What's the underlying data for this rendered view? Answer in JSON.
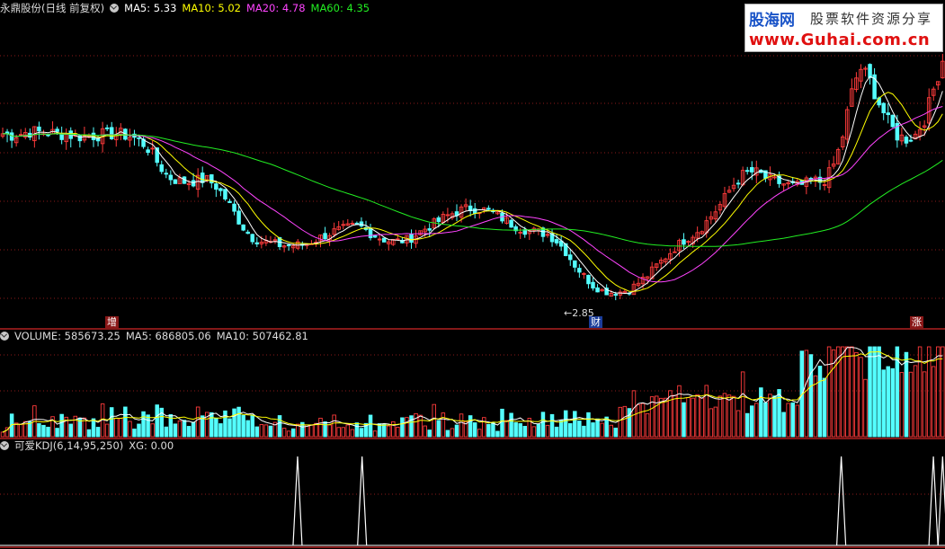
{
  "main_panel": {
    "stock_name": "永鼎股份",
    "period_label": "(日线 前复权)",
    "indicators": [
      {
        "label": "MA5: 5.33",
        "color": "#ffffff"
      },
      {
        "label": "MA10: 5.02",
        "color": "#ffff00"
      },
      {
        "label": "MA20: 4.78",
        "color": "#ff44ff"
      },
      {
        "label": "MA60: 4.35",
        "color": "#22ee22"
      }
    ],
    "low_marker": "←2.85",
    "markers": [
      {
        "label": "增",
        "bg": "#8a1818"
      },
      {
        "label": "财",
        "bg": "#1a3c9a"
      },
      {
        "label": "涨",
        "bg": "#8a1818"
      }
    ]
  },
  "volume_panel": {
    "title": "VOLUME: 585673.25",
    "ma5": "MA5: 686805.06",
    "ma10": "MA10: 507462.81"
  },
  "kdj_panel": {
    "title": "可爱KDJ(6,14,95,250)",
    "xg": "XG: 0.00"
  },
  "logo": {
    "brand": "股海网",
    "tagline": "股票软件资源分享",
    "url": "www.Guhai.com.cn"
  },
  "colors": {
    "up": "#ff3b3b",
    "down": "#54ffff",
    "ma5": "#ffffff",
    "ma10": "#ffff00",
    "ma20": "#ff44ff",
    "ma60": "#22ee22",
    "grid": "#8b1a1a"
  },
  "chart_data": {
    "type": "candlestick",
    "price_low_annotation": 2.85,
    "ma_last": {
      "MA5": 5.33,
      "MA10": 5.02,
      "MA20": 4.78,
      "MA60": 4.35
    },
    "close_series_approx": [
      5.02,
      5.0,
      5.02,
      5.05,
      5.04,
      5.03,
      5.02,
      5.01,
      4.99,
      4.98,
      5.0,
      5.01,
      5.02,
      5.01,
      4.98,
      4.92,
      4.8,
      4.6,
      4.45,
      4.4,
      4.38,
      4.4,
      4.42,
      4.35,
      4.2,
      4.0,
      3.8,
      3.65,
      3.6,
      3.58,
      3.55,
      3.54,
      3.55,
      3.57,
      3.62,
      3.68,
      3.73,
      3.76,
      3.79,
      3.78,
      3.7,
      3.64,
      3.6,
      3.6,
      3.62,
      3.7,
      3.78,
      3.84,
      3.92,
      3.98,
      4.02,
      4.04,
      4.02,
      3.98,
      3.92,
      3.84,
      3.78,
      3.74,
      3.72,
      3.7,
      3.62,
      3.48,
      3.3,
      3.15,
      3.02,
      2.95,
      2.92,
      2.93,
      2.96,
      3.05,
      3.15,
      3.28,
      3.4,
      3.52,
      3.62,
      3.7,
      3.8,
      3.95,
      4.1,
      4.3,
      4.45,
      4.52,
      4.5,
      4.42,
      4.38,
      4.35,
      4.32,
      4.35,
      4.4,
      4.38,
      4.55,
      4.9,
      5.5,
      5.9,
      5.75,
      5.45,
      5.2,
      5.0,
      4.95,
      5.0,
      5.2,
      5.6,
      6.0
    ],
    "volume_last": 585673.25,
    "volume_ma5": 686805.06,
    "volume_ma10": 507462.81,
    "kdj_params": [
      6,
      14,
      95,
      250
    ],
    "xg_last": 0.0,
    "xg_signal_indices": [
      32,
      39,
      91,
      101,
      102
    ]
  }
}
